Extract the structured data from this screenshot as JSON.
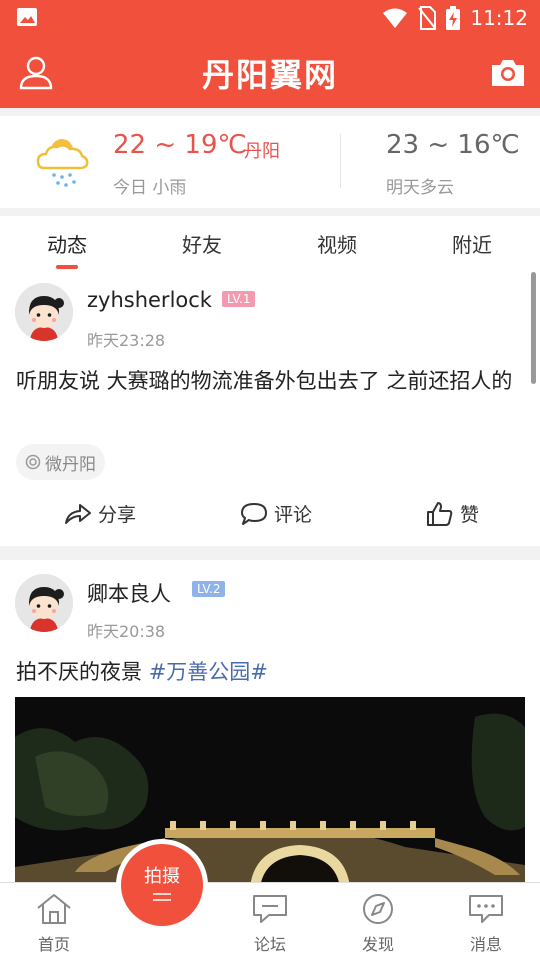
{
  "status_bar": {
    "time": "11:12"
  },
  "app": {
    "logo": "丹阳翼网"
  },
  "weather": {
    "today_temp": "22 ~ 19℃",
    "city": "丹阳",
    "today_desc": "今日 小雨",
    "tomorrow_temp": "23 ~ 16℃",
    "tomorrow_desc": "明天多云"
  },
  "tabs": [
    {
      "label": "动态"
    },
    {
      "label": "好友"
    },
    {
      "label": "视频"
    },
    {
      "label": "附近"
    }
  ],
  "posts": [
    {
      "username": "zyhsherlock",
      "level": "LV.1",
      "time": "昨天23:28",
      "text": "听朋友说 大赛璐的物流准备外包出去了 之前还招人的",
      "channel": "微丹阳",
      "actions": {
        "share": "分享",
        "comment": "评论",
        "like": "赞"
      }
    },
    {
      "username": "卿本良人",
      "level": "LV.2",
      "time": "昨天20:38",
      "text": "拍不厌的夜景 ",
      "topic": "#万善公园#"
    }
  ],
  "bottom_nav": {
    "home": "首页",
    "shoot": "拍摄",
    "forum": "论坛",
    "discover": "发现",
    "messages": "消息"
  },
  "colors": {
    "brand": "#f0503c",
    "lv1": "#f49ab0",
    "lv2": "#8fb3e8",
    "topic": "#4a6bb0"
  }
}
